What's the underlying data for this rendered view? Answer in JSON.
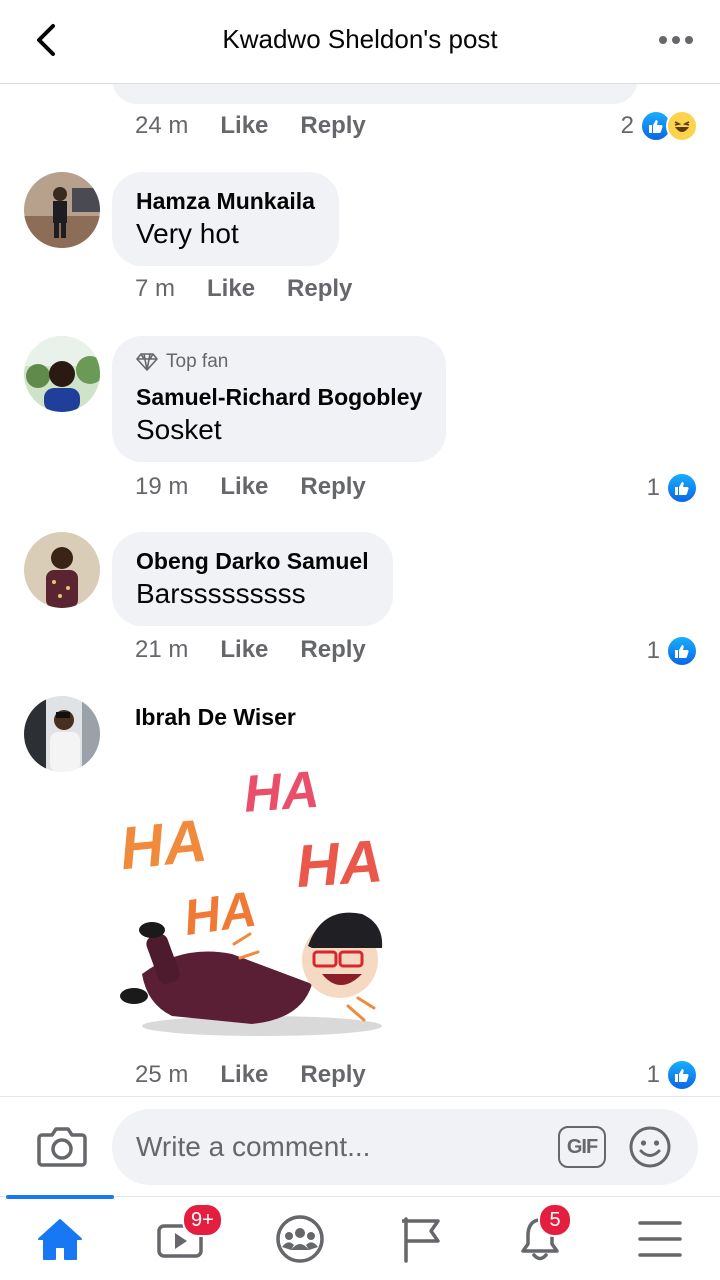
{
  "header": {
    "title": "Kwadwo Sheldon's post"
  },
  "comments": [
    {
      "id": "prev",
      "time": "24 m",
      "like_label": "Like",
      "reply_label": "Reply",
      "reaction_count": "2",
      "reactions": [
        "like",
        "haha"
      ]
    },
    {
      "id": "hamza",
      "author": "Hamza Munkaila",
      "text": "Very hot",
      "time": "7 m",
      "like_label": "Like",
      "reply_label": "Reply"
    },
    {
      "id": "samuel-richard",
      "badge": "Top fan",
      "author": "Samuel-Richard Bogobley",
      "text": "Sosket",
      "time": "19 m",
      "like_label": "Like",
      "reply_label": "Reply",
      "reaction_count": "1",
      "reactions": [
        "like"
      ]
    },
    {
      "id": "obeng",
      "author": "Obeng Darko Samuel",
      "text": "Barsssssssss",
      "time": "21 m",
      "like_label": "Like",
      "reply_label": "Reply",
      "reaction_count": "1",
      "reactions": [
        "like"
      ]
    },
    {
      "id": "ibrah",
      "author": "Ibrah De Wiser",
      "sticker_text": [
        "HA",
        "HA",
        "HA",
        "HA"
      ],
      "time": "25 m",
      "like_label": "Like",
      "reply_label": "Reply",
      "reaction_count": "1",
      "reactions": [
        "like"
      ]
    }
  ],
  "composer": {
    "placeholder": "Write a comment...",
    "gif_label": "GIF"
  },
  "tabbar": {
    "active": "home",
    "tabs": [
      {
        "name": "home",
        "icon": "home-icon"
      },
      {
        "name": "watch",
        "icon": "video-icon",
        "badge": "9+"
      },
      {
        "name": "groups",
        "icon": "groups-icon"
      },
      {
        "name": "pages",
        "icon": "flag-icon"
      },
      {
        "name": "notifications",
        "icon": "bell-icon",
        "badge": "5"
      },
      {
        "name": "menu",
        "icon": "menu-icon"
      }
    ]
  },
  "colors": {
    "accent": "#1877f2",
    "bubble": "#f0f2f5",
    "secondary_text": "#65676b",
    "badge": "#e41e3f"
  }
}
